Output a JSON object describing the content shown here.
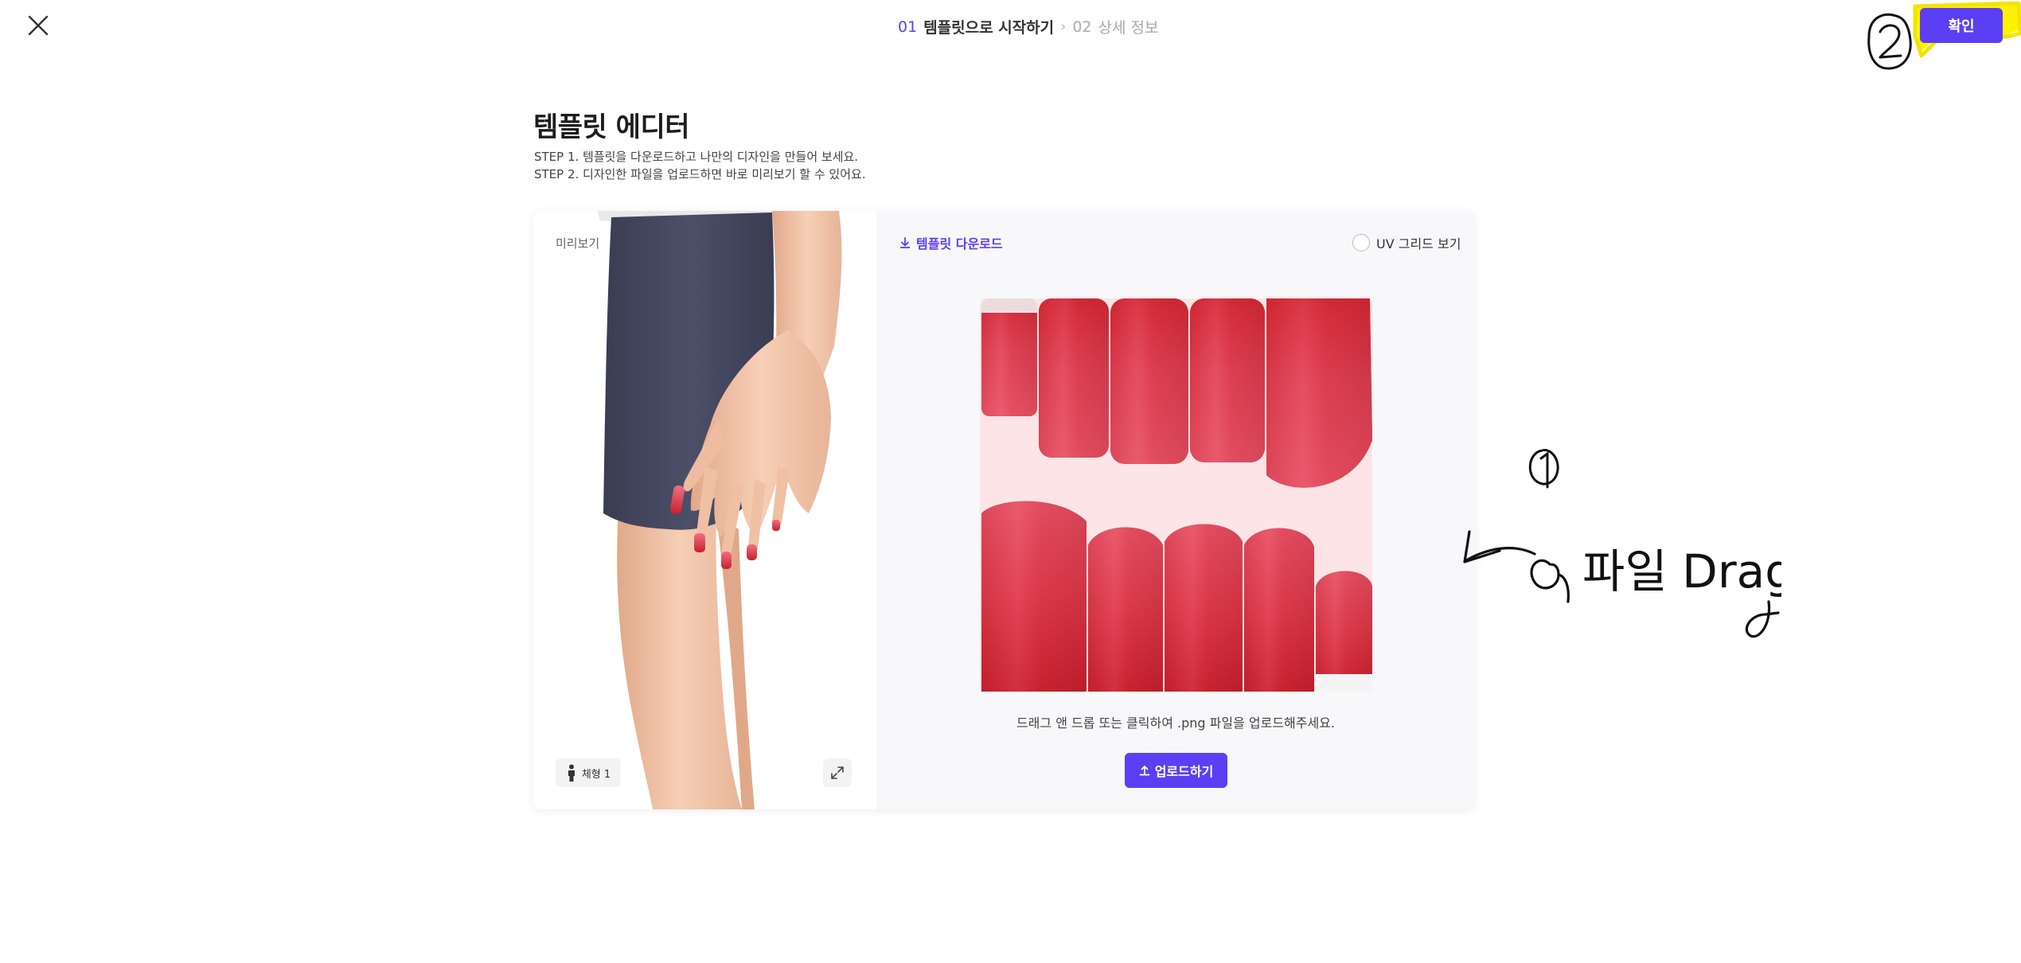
{
  "header": {
    "step1_num": "01",
    "step1_label": "템플릿으로 시작하기",
    "step2_num": "02",
    "step2_label": "상세 정보",
    "confirm_label": "확인"
  },
  "main": {
    "title": "템플릿 에디터",
    "desc_line1": "STEP 1. 템플릿을 다운로드하고 나만의 디자인을 만들어 보세요.",
    "desc_line2": "STEP 2. 디자인한 파일을 업로드하면 바로 미리보기 할 수 있어요."
  },
  "preview": {
    "label": "미리보기",
    "body_type_label": "체형 1"
  },
  "editor": {
    "download_label": "템플릿 다운로드",
    "uv_label": "UV 그리드 보기",
    "drop_hint": "드래그 앤 드롭 또는 클릭하여 .png 파일을 업로드해주세요.",
    "upload_label": "업로드하기"
  },
  "annotations": {
    "marker_1": "1",
    "marker_2": "2",
    "drag_note": "파일 Drag"
  },
  "colors": {
    "accent": "#5b3ff5",
    "highlight": "#fff200",
    "nail_red": "#d42a35"
  }
}
